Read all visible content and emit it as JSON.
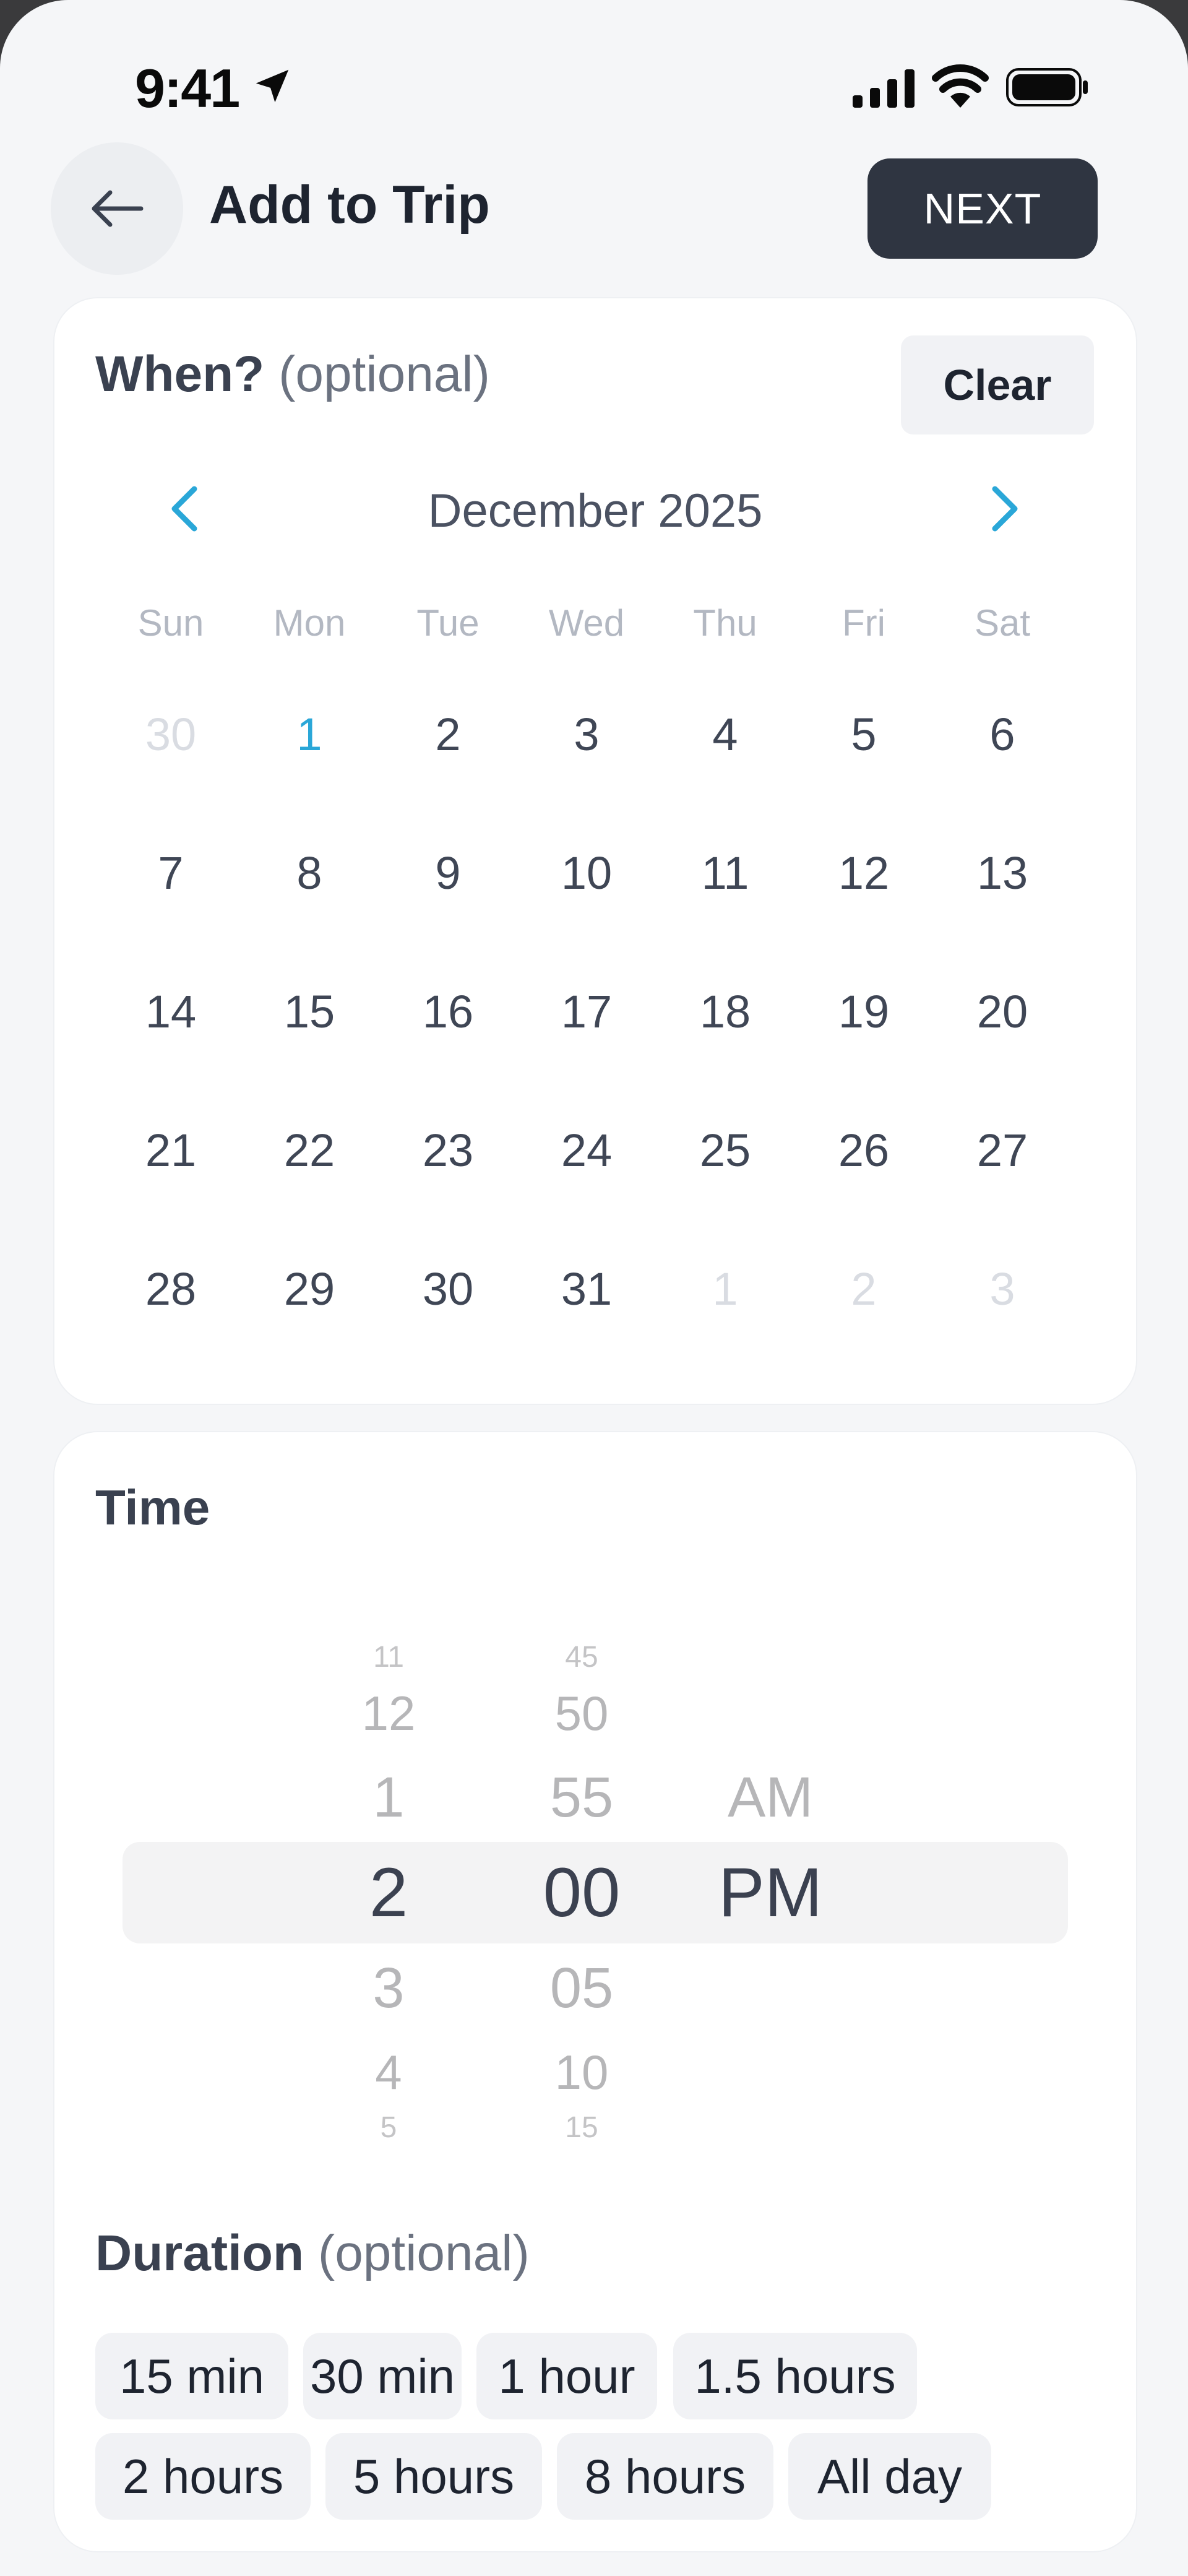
{
  "status_bar": {
    "time": "9:41"
  },
  "header": {
    "title": "Add to Trip",
    "next_label": "NEXT"
  },
  "when": {
    "title": "When?",
    "optional": "(optional)",
    "clear_label": "Clear",
    "month_label": "December 2025",
    "weekdays": [
      "Sun",
      "Mon",
      "Tue",
      "Wed",
      "Thu",
      "Fri",
      "Sat"
    ],
    "weeks": [
      [
        {
          "d": "30",
          "m": true
        },
        {
          "d": "1",
          "t": true
        },
        {
          "d": "2"
        },
        {
          "d": "3"
        },
        {
          "d": "4"
        },
        {
          "d": "5"
        },
        {
          "d": "6"
        }
      ],
      [
        {
          "d": "7"
        },
        {
          "d": "8"
        },
        {
          "d": "9"
        },
        {
          "d": "10"
        },
        {
          "d": "11"
        },
        {
          "d": "12"
        },
        {
          "d": "13"
        }
      ],
      [
        {
          "d": "14"
        },
        {
          "d": "15"
        },
        {
          "d": "16"
        },
        {
          "d": "17"
        },
        {
          "d": "18"
        },
        {
          "d": "19"
        },
        {
          "d": "20"
        }
      ],
      [
        {
          "d": "21"
        },
        {
          "d": "22"
        },
        {
          "d": "23"
        },
        {
          "d": "24"
        },
        {
          "d": "25"
        },
        {
          "d": "26"
        },
        {
          "d": "27"
        }
      ],
      [
        {
          "d": "28"
        },
        {
          "d": "29"
        },
        {
          "d": "30"
        },
        {
          "d": "31"
        },
        {
          "d": "1",
          "m": true
        },
        {
          "d": "2",
          "m": true
        },
        {
          "d": "3",
          "m": true
        }
      ]
    ]
  },
  "time": {
    "title": "Time",
    "hours": [
      "11",
      "12",
      "1",
      "2",
      "3",
      "4",
      "5"
    ],
    "minutes": [
      "45",
      "50",
      "55",
      "00",
      "05",
      "10",
      "15"
    ],
    "periods": [
      "AM",
      "PM"
    ],
    "selected_hour": "2",
    "selected_minute": "00",
    "selected_period": "PM"
  },
  "duration": {
    "title": "Duration",
    "optional": "(optional)",
    "options": [
      "15 min",
      "30 min",
      "1 hour",
      "1.5 hours",
      "2 hours",
      "5 hours",
      "8 hours",
      "All day"
    ]
  },
  "colors": {
    "accent": "#2aa7d8",
    "primary_button": "#2f3541"
  }
}
